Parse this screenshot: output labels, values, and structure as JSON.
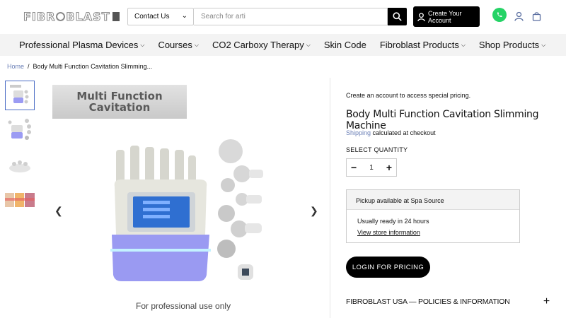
{
  "header": {
    "logo_text_left": "FIBR",
    "logo_text_right": "BLAST",
    "contact_label": "Contact Us",
    "search_placeholder": "Search for arti",
    "account_label": "Create Your\nAccount"
  },
  "nav": {
    "items": [
      {
        "label": "Professional Plasma Devices"
      },
      {
        "label": "Courses"
      },
      {
        "label": "CO2 Carboxy Therapy"
      },
      {
        "label": "Skin Code"
      },
      {
        "label": "Fibroblast Products"
      },
      {
        "label": "Shop Products"
      }
    ]
  },
  "breadcrumb": {
    "home": "Home",
    "separator": "/",
    "current": "Body Multi Function Cavitation Slimming..."
  },
  "gallery": {
    "banner_line1": "Multi Function",
    "banner_line2": "Cavitation",
    "footer_note": "For professional use only"
  },
  "product": {
    "promo": "Create an account to access special pricing.",
    "title": "Body Multi Function Cavitation Slimming Machine",
    "shipping_link": "Shipping",
    "shipping_text": " calculated at checkout",
    "qty_label": "SELECT QUANTITY",
    "qty_value": "1",
    "qty_minus": "−",
    "qty_plus": "+",
    "pickup_head": "Pickup available at Spa Source",
    "pickup_ready": "Usually ready in 24 hours",
    "pickup_link": "View store information",
    "login_button": "LOGIN FOR PRICING",
    "policies": "FIBROBLAST USA — POLICIES & INFORMATION",
    "policies_toggle": "+"
  },
  "colors": {
    "accent_link": "#6a7fb6",
    "whatsapp": "#25d366",
    "machine_glow": "#8e8ef0"
  }
}
